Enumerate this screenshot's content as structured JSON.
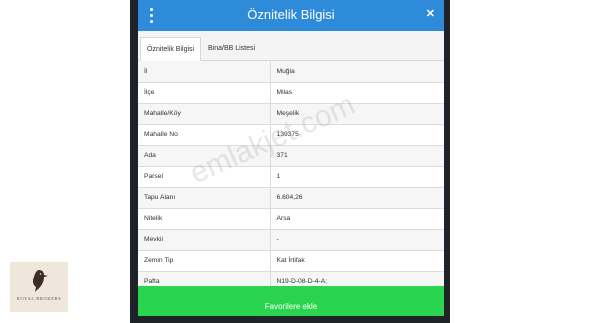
{
  "dialog": {
    "title": "Öznitelik Bilgisi",
    "menu_icon": "vertical-dots-icon",
    "close_icon": "close-icon",
    "close_glyph": "✕"
  },
  "tabs": [
    {
      "label": "Öznitelik Bilgisi",
      "active": true
    },
    {
      "label": "Bina/BB Listesi",
      "active": false
    }
  ],
  "attributes": [
    {
      "label": "İl",
      "value": "Muğla"
    },
    {
      "label": "İlçe",
      "value": "Milas"
    },
    {
      "label": "Mahalle/Köy",
      "value": "Meşelik"
    },
    {
      "label": "Mahalle No",
      "value": "139375"
    },
    {
      "label": "Ada",
      "value": "371"
    },
    {
      "label": "Parsel",
      "value": "1"
    },
    {
      "label": "Tapu Alanı",
      "value": "6.604,26"
    },
    {
      "label": "Nitelik",
      "value": "Arsa"
    },
    {
      "label": "Mevkii",
      "value": "-"
    },
    {
      "label": "Zemin Tip",
      "value": "Kat İrtifak"
    },
    {
      "label": "Pafta",
      "value": "N19-D-08-D-4-A;"
    }
  ],
  "favorite_button": {
    "label": "Favorilere ekle"
  },
  "watermark": {
    "text": "emlakjet.com"
  },
  "logo": {
    "text": "ROYAL BROKERS",
    "icon": "bird-logo-icon"
  },
  "colors": {
    "title_bar": "#2d8bd9",
    "button": "#2bd44e",
    "backdrop_panel": "#1d2329"
  }
}
